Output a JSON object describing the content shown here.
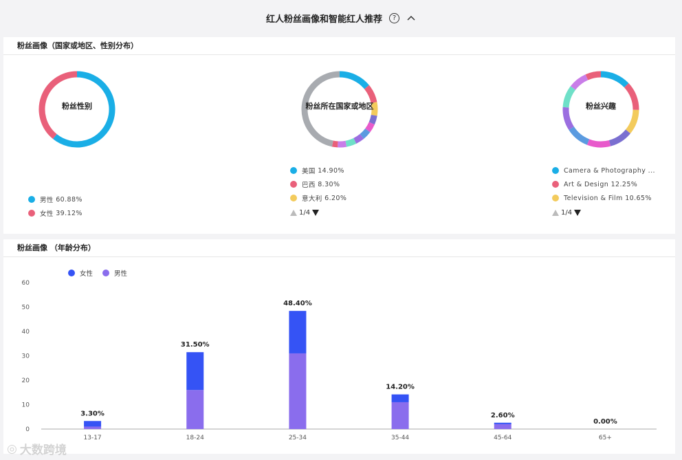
{
  "header": {
    "title": "红人粉丝画像和智能红人推荐",
    "help_symbol": "?"
  },
  "panel1": {
    "title": "粉丝画像（国家或地区、性别分布）",
    "gender": {
      "label": "粉丝性别",
      "items": [
        {
          "name": "男性",
          "pct": "60.88%",
          "value": 60.88,
          "color": "#1aaee6"
        },
        {
          "name": "女性",
          "pct": "39.12%",
          "value": 39.12,
          "color": "#e9607a"
        }
      ]
    },
    "country": {
      "label": "粉丝所在国家或地区",
      "items": [
        {
          "name": "美国",
          "pct": "14.90%",
          "color": "#1aaee6"
        },
        {
          "name": "巴西",
          "pct": "8.30%",
          "color": "#e9607a"
        },
        {
          "name": "意大利",
          "pct": "6.20%",
          "color": "#f3cb5c"
        }
      ],
      "segments": [
        {
          "value": 14.9,
          "color": "#1aaee6"
        },
        {
          "value": 8.3,
          "color": "#e9607a"
        },
        {
          "value": 6.2,
          "color": "#f3cb5c"
        },
        {
          "value": 4,
          "color": "#7a6fd0"
        },
        {
          "value": 4,
          "color": "#e85acb"
        },
        {
          "value": 4,
          "color": "#5b9be0"
        },
        {
          "value": 4,
          "color": "#9b6ee0"
        },
        {
          "value": 4.5,
          "color": "#6fe0c8"
        },
        {
          "value": 4,
          "color": "#c97de8"
        },
        {
          "value": 2.5,
          "color": "#e9607a"
        },
        {
          "value": 49.6,
          "color": "#a8abb0"
        }
      ],
      "pager": "1/4"
    },
    "interest": {
      "label": "粉丝兴趣",
      "items": [
        {
          "name": "Camera & Photography ...",
          "pct": "",
          "color": "#1aaee6"
        },
        {
          "name": "Art & Design",
          "pct": "12.25%",
          "color": "#e9607a"
        },
        {
          "name": "Television & Film",
          "pct": "10.65%",
          "color": "#f3cb5c"
        }
      ],
      "segments": [
        {
          "value": 13,
          "color": "#1aaee6"
        },
        {
          "value": 12.25,
          "color": "#e9607a"
        },
        {
          "value": 10.65,
          "color": "#f3cb5c"
        },
        {
          "value": 10,
          "color": "#7a6fd0"
        },
        {
          "value": 10,
          "color": "#e85acb"
        },
        {
          "value": 10,
          "color": "#5b9be0"
        },
        {
          "value": 10,
          "color": "#9b6ee0"
        },
        {
          "value": 9.5,
          "color": "#6fe0c8"
        },
        {
          "value": 8,
          "color": "#c97de8"
        },
        {
          "value": 6.6,
          "color": "#e9607a"
        }
      ],
      "pager": "1/4"
    }
  },
  "panel2": {
    "title": "粉丝画像 （年龄分布）"
  },
  "chart_data": {
    "type": "bar",
    "stacked": true,
    "categories": [
      "13-17",
      "18-24",
      "25-34",
      "35-44",
      "45-64",
      "65+"
    ],
    "series": [
      {
        "name": "女性",
        "color": "#3553f5",
        "values": [
          2.3,
          15.5,
          17.4,
          3.2,
          0.6,
          0
        ]
      },
      {
        "name": "男性",
        "color": "#8a6ded",
        "values": [
          1.0,
          16.0,
          31.0,
          11.0,
          2.0,
          0
        ]
      }
    ],
    "totals": [
      "3.30%",
      "31.50%",
      "48.40%",
      "14.20%",
      "2.60%",
      "0.00%"
    ],
    "total_values": [
      3.3,
      31.5,
      48.4,
      14.2,
      2.6,
      0
    ],
    "ylim": [
      0,
      60
    ],
    "yticks": [
      0,
      10,
      20,
      30,
      40,
      50,
      60
    ],
    "legend_position": "top-left",
    "grid": false
  },
  "watermark": {
    "text": "大数跨境"
  }
}
